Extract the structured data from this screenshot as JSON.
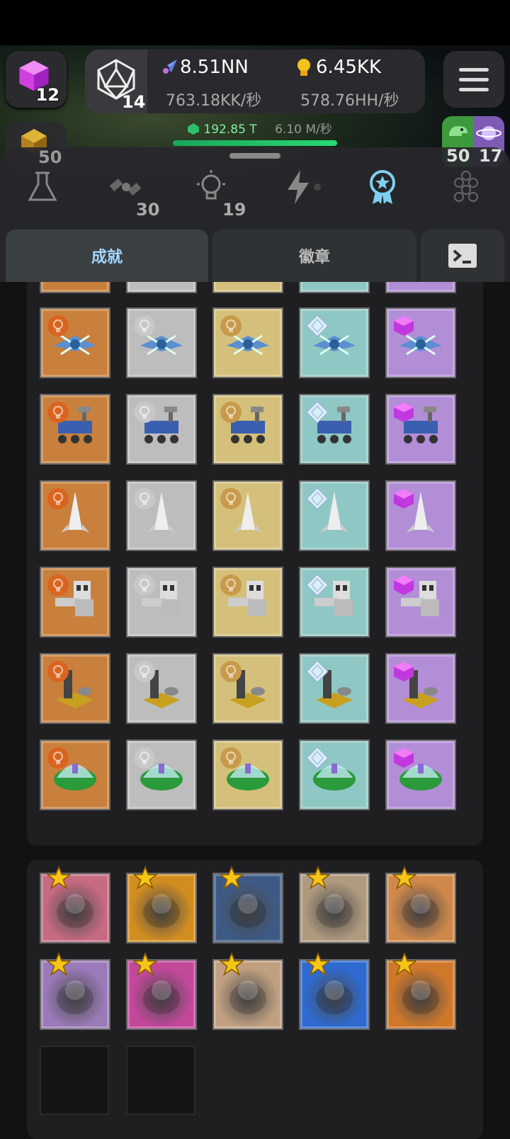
{
  "top_bar": {
    "cube_count": "12",
    "dice_count": "14",
    "rocket_value": "8.51NN",
    "rocket_rate": "763.18KK/秒",
    "bulb_value": "6.45KK",
    "bulb_rate": "578.76HH/秒",
    "gem_value": "192.85 T",
    "gem_rate": "6.10 M/秒",
    "left_count": "50",
    "right_counts": [
      "50",
      "17"
    ]
  },
  "category_icons": [
    {
      "name": "flask-icon",
      "count": ""
    },
    {
      "name": "satellite-icon",
      "count": "30"
    },
    {
      "name": "lightbulb-icon",
      "count": "19"
    },
    {
      "name": "lightning-icon",
      "count": ""
    },
    {
      "name": "award-ribbon-icon",
      "count": ""
    },
    {
      "name": "hexagon-grid-icon",
      "count": ""
    }
  ],
  "tabs": {
    "achievements": "成就",
    "badges": "徽章",
    "console_icon": "terminal-icon"
  },
  "achievement_rows": [
    "drone",
    "rover",
    "shuttle",
    "robot",
    "tower",
    "biodome"
  ],
  "tiers": [
    {
      "name": "bronze",
      "bg": "#c9803d",
      "badge": "#d96420"
    },
    {
      "name": "silver",
      "bg": "#bdbdbd",
      "badge": "#c8c8c8"
    },
    {
      "name": "gold",
      "bg": "#d4c07a",
      "badge": "#c89a4a"
    },
    {
      "name": "diamond",
      "bg": "#8fc7c4",
      "badge": "#d8f0f5"
    },
    {
      "name": "amethyst",
      "bg": "#b28ed6",
      "badge": "#c238e0"
    }
  ],
  "special_badges": [
    {
      "name": "shark-portrait",
      "bg": "#c56a80"
    },
    {
      "name": "crown-portrait",
      "bg": "#d28d20"
    },
    {
      "name": "blue-creature-portrait",
      "bg": "#3d5a85"
    },
    {
      "name": "old-man-portrait",
      "bg": "#b09a7e"
    },
    {
      "name": "mushroom-creature-portrait",
      "bg": "#d0884a"
    },
    {
      "name": "purple-dragon-portrait",
      "bg": "#9a7ab8"
    },
    {
      "name": "pink-dolphin-portrait",
      "bg": "#c2489a"
    },
    {
      "name": "blue-fish-portrait",
      "bg": "#c0a080"
    },
    {
      "name": "blue-monster-portrait",
      "bg": "#2e6ad0"
    },
    {
      "name": "fox-portrait",
      "bg": "#d0782a"
    }
  ]
}
